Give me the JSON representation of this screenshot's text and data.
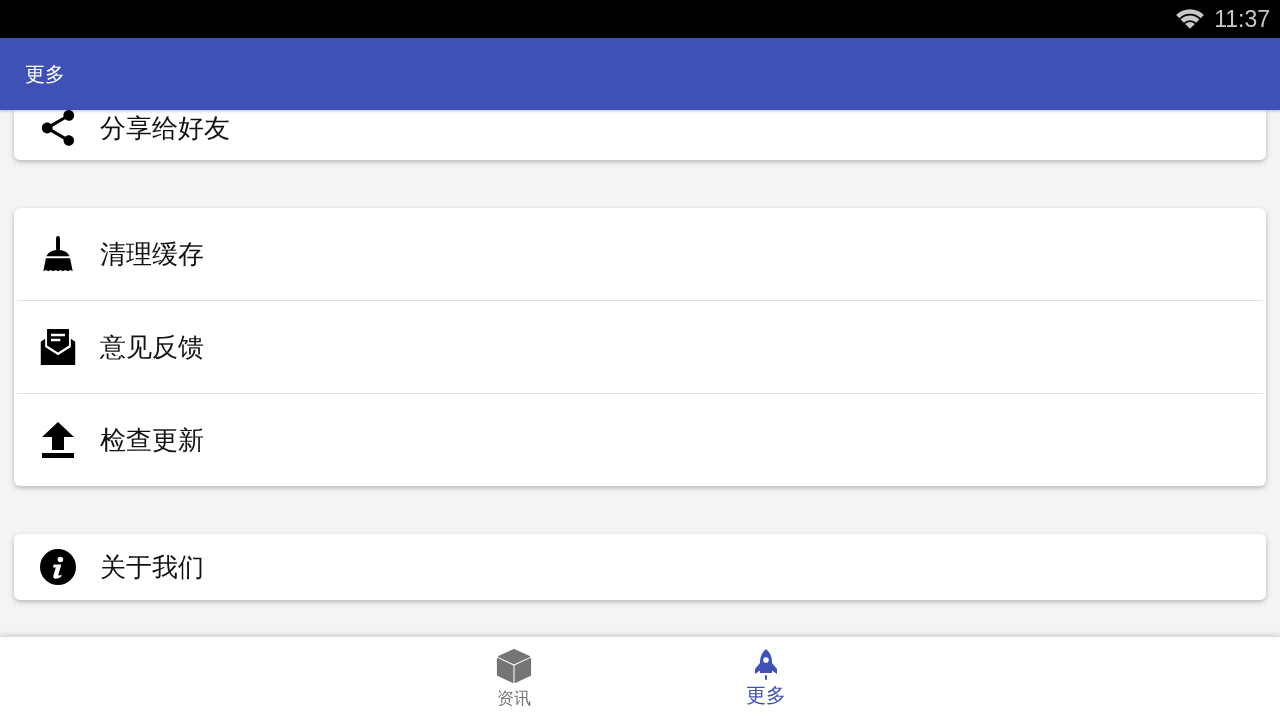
{
  "status_bar": {
    "time": "11:37"
  },
  "app_bar": {
    "title": "更多"
  },
  "groups": [
    {
      "items": [
        {
          "label": "分享给好友"
        }
      ]
    },
    {
      "items": [
        {
          "label": "清理缓存"
        },
        {
          "label": "意见反馈"
        },
        {
          "label": "检查更新"
        }
      ]
    },
    {
      "items": [
        {
          "label": "关于我们"
        }
      ]
    }
  ],
  "bottom_nav": {
    "tabs": [
      {
        "label": "资讯",
        "selected": false
      },
      {
        "label": "更多",
        "selected": true
      }
    ]
  }
}
